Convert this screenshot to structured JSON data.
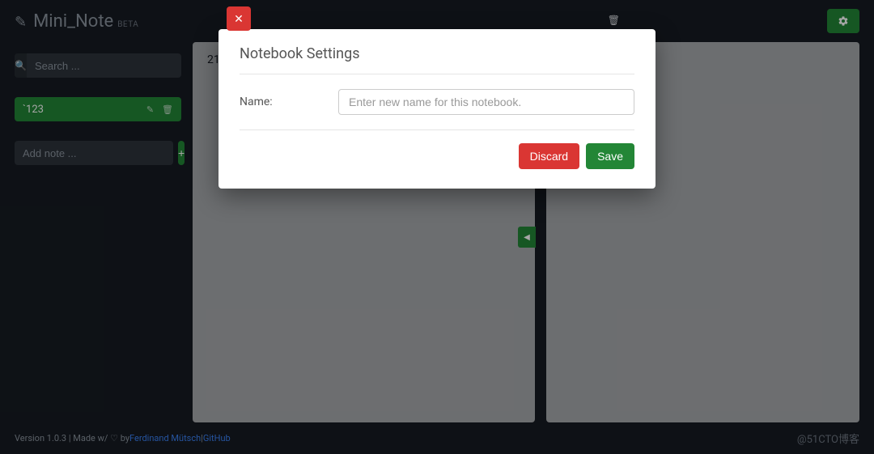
{
  "header": {
    "title": "Mini_Note",
    "beta": "BETA"
  },
  "sidebar": {
    "search_placeholder": "Search ...",
    "notebook": {
      "name": "`123"
    },
    "addnote_placeholder": "Add note ...",
    "addnote_symbol": "+"
  },
  "editor": {
    "left_content": "21"
  },
  "modal": {
    "title": "Notebook Settings",
    "name_label": "Name:",
    "name_placeholder": "Enter new name for this notebook.",
    "discard": "Discard",
    "save": "Save"
  },
  "footer": {
    "version_prefix": "Version 1.0.3 | Made w/ ♡ by ",
    "author": "Ferdinand Mütsch",
    "sep": " | ",
    "github": "GitHub"
  },
  "watermark": "@51CTO博客"
}
